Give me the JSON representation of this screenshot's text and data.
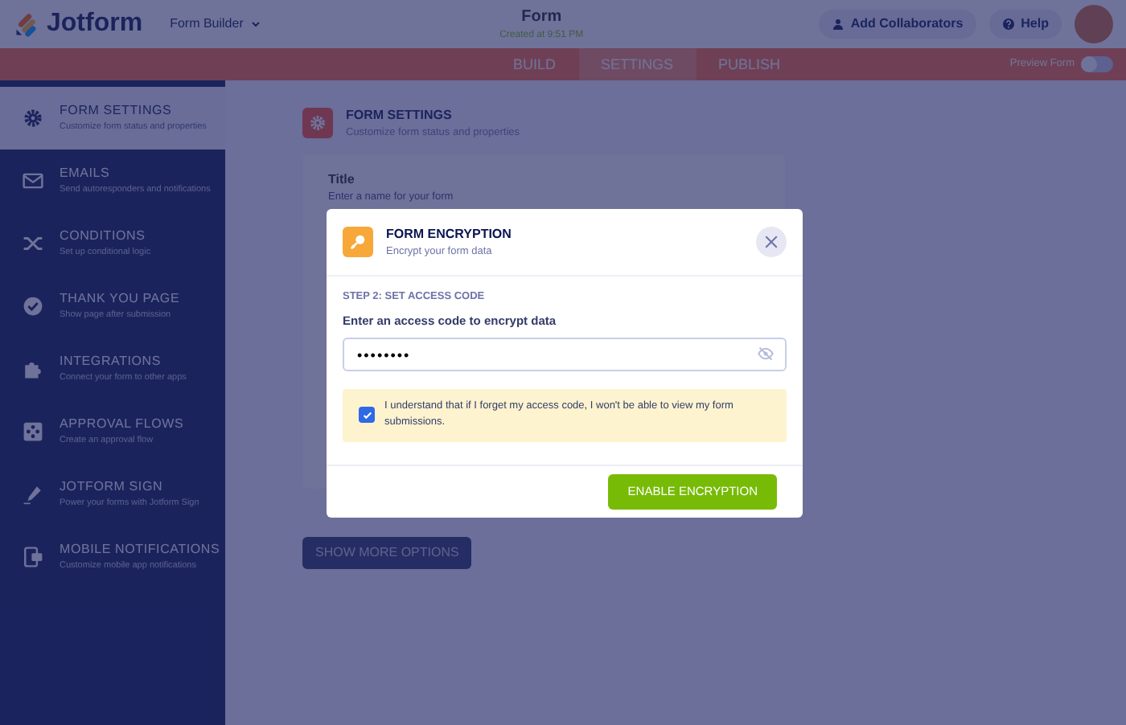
{
  "header": {
    "logo": "Jotform",
    "builder": "Form Builder",
    "title": "Form",
    "subtitle": "Created at 9:51 PM",
    "buttons": [
      {
        "kind": "user",
        "label": "Add Collaborators"
      },
      {
        "kind": "help",
        "label": "Help"
      }
    ]
  },
  "tabs": [
    {
      "label": "BUILD",
      "selected": false
    },
    {
      "label": "SETTINGS",
      "selected": true
    },
    {
      "label": "PUBLISH",
      "selected": false
    }
  ],
  "preview": {
    "label": "Preview Form",
    "on": false
  },
  "sidebar": {
    "items": [
      {
        "kind": "gear",
        "title": "FORM SETTINGS",
        "desc": "Customize form status and properties",
        "selected": true
      },
      {
        "kind": "mail",
        "title": "EMAILS",
        "desc": "Send autoresponders and notifications",
        "selected": false
      },
      {
        "kind": "shuffle",
        "title": "CONDITIONS",
        "desc": "Set up conditional logic",
        "selected": false
      },
      {
        "kind": "check",
        "title": "THANK YOU PAGE",
        "desc": "Show page after submission",
        "selected": false
      },
      {
        "kind": "puzzle",
        "title": "INTEGRATIONS",
        "desc": "Connect your form to other apps",
        "selected": false
      },
      {
        "kind": "flow",
        "title": "APPROVAL FLOWS",
        "desc": "Create an approval flow",
        "selected": false
      },
      {
        "kind": "pen",
        "title": "JOTFORM SIGN",
        "desc": "Power your forms with Jotform Sign",
        "selected": false
      },
      {
        "kind": "phone",
        "title": "MOBILE NOTIFICATIONS",
        "desc": "Customize mobile app notifications",
        "selected": false
      }
    ]
  },
  "content": {
    "title": "FORM SETTINGS",
    "desc": "Customize form status and properties",
    "field_title": "Title",
    "field_hint": "Enter a name for your form",
    "more_button": "SHOW MORE OPTIONS"
  },
  "modal": {
    "title": "FORM ENCRYPTION",
    "subtitle": "Encrypt your form data",
    "step": "STEP 2: SET ACCESS CODE",
    "label": "Enter an access code to encrypt data",
    "value": "••••••••",
    "agree": {
      "checked": true,
      "text": "I understand that if I forget my access code, I won't be able to view my form submissions."
    },
    "button": "ENABLE ENCRYPTION"
  }
}
